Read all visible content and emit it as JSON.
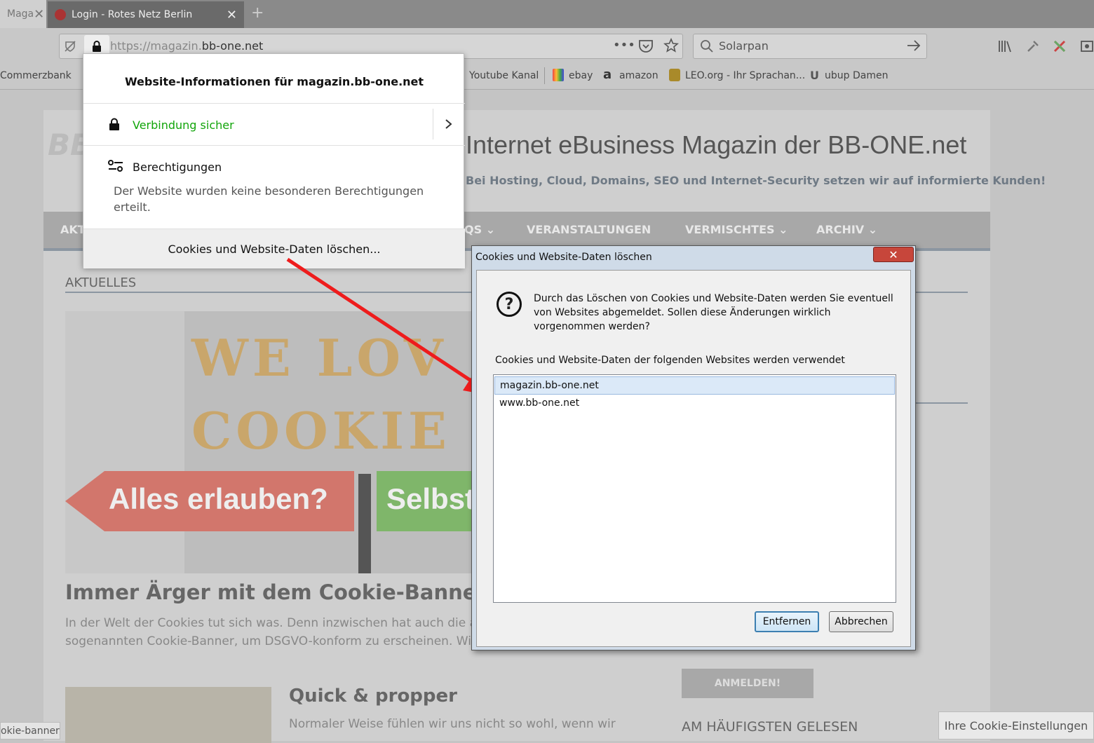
{
  "browser": {
    "tabs": [
      {
        "label": "Maga",
        "close": "✕"
      },
      {
        "label": "Login - Rotes Netz Berlin",
        "close": "✕"
      }
    ],
    "new_tab": "+",
    "url_prefix": "https://magazin.",
    "url_domain": "bb-one.net",
    "search_value": "Solarpan",
    "bookmarks": [
      "Commerzbank",
      "Youtube Kanal",
      "ebay",
      "amazon",
      "LEO.org - Ihr Sprachan...",
      "ubup Damen"
    ]
  },
  "site": {
    "title": "Internet eBusiness Magazin der BB-ONE.net",
    "subtitle": "Bei Hosting, Cloud, Domains, SEO und Internet-Security setzen wir auf informierte Kunden!",
    "nav": [
      "AKT",
      "QS ⌄",
      "VERANSTALTUNGEN",
      "VERMISCHTES ⌄",
      "ARCHIV ⌄"
    ],
    "section_label": "AKTUELLES",
    "hero_text": {
      "line1": "WE LOV",
      "line2": "COOKIE",
      "sign_left": "Alles erlauben?",
      "sign_right": "Selbst"
    },
    "article1": {
      "title": "Immer Ärger mit dem Cookie-Banner",
      "line1": "In der Welt der Cookies tut sich was. Denn inzwischen hat auch die aller",
      "line2": "sogenannten Cookie-Banner, um DSGVO-konform zu erscheinen. Wie g"
    },
    "article2": {
      "title": "Quick & propper",
      "line1": "Normaler Weise fühlen wir uns nicht so wohl, wenn wir"
    },
    "login_button": "ANMELDEN!",
    "popular_label": "AM HÄUFIGSTEN GELESEN",
    "cookie_settings_button": "Ihre Cookie-Einstellungen",
    "status_url": "okie-banner/"
  },
  "site_info_popup": {
    "title": "Website-Informationen für magazin.bb-one.net",
    "connection": "Verbindung sicher",
    "permissions_label": "Berechtigungen",
    "permissions_desc": "Der Website wurden keine besonderen Berechtigungen erteilt.",
    "clear_button": "Cookies und Website-Daten löschen..."
  },
  "dialog": {
    "title": "Cookies und Website-Daten löschen",
    "close": "✕",
    "message": "Durch das Löschen von Cookies und Website-Daten werden Sie eventuell von Websites abgemeldet. Sollen diese Änderungen wirklich vorgenommen werden?",
    "list_label": "Cookies und Website-Daten der folgenden Websites werden verwendet",
    "sites": [
      "magazin.bb-one.net",
      "www.bb-one.net"
    ],
    "remove_button": "Entfernen",
    "cancel_button": "Abbrechen"
  },
  "colors": {
    "secure_green": "#12a50a",
    "arrow_red": "#ee1c1c",
    "dialog_close": "#c7463b"
  }
}
